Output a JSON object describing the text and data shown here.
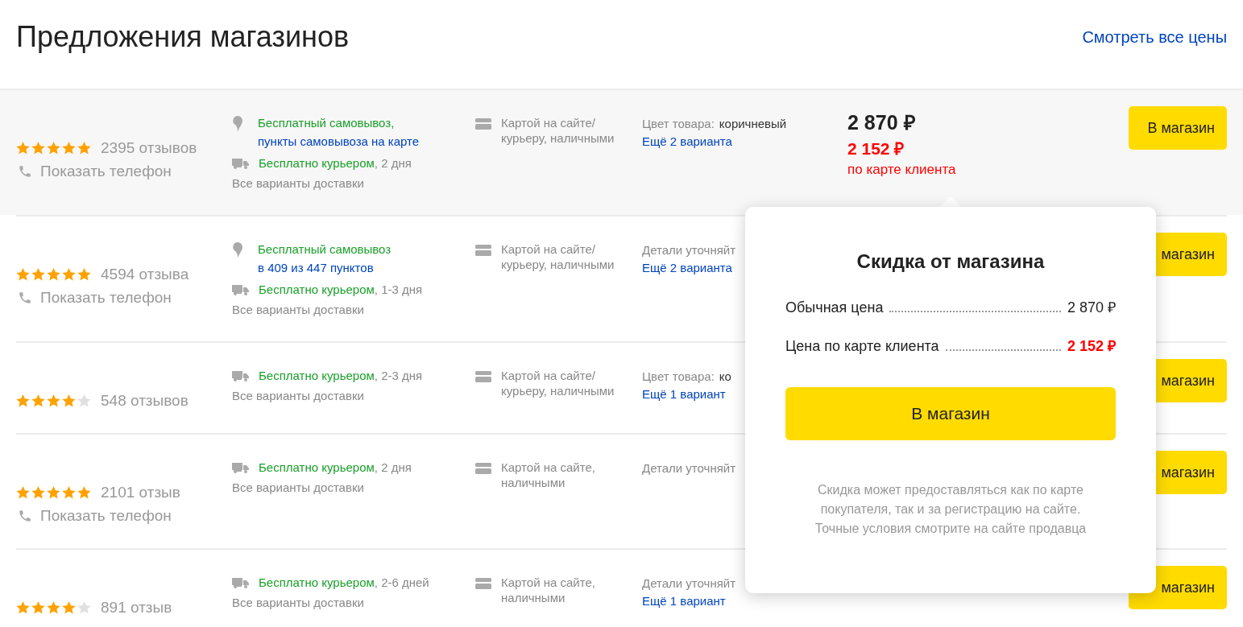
{
  "header": {
    "title": "Предложения магазинов",
    "link": "Смотреть все цены"
  },
  "rows": [
    {
      "highlighted": true,
      "stars": 5,
      "reviews": "2395 отзывов",
      "phone": "Показать телефон",
      "delivery": [
        {
          "kind": "pickup",
          "title": "Бесплатный самовывоз,",
          "note": "пункты самовывоза на карте"
        },
        {
          "kind": "courier",
          "title": "Бесплатно курьером",
          "term": ", 2 дня"
        }
      ],
      "all_delivery": "Все варианты доставки",
      "payment": "Картой на сайте/ курьеру, наличными",
      "details": {
        "label": "Цвет товара:",
        "value": "коричневый"
      },
      "variants": "Ещё 2 варианта",
      "price": {
        "regular": "2 870 ₽",
        "card": "2 152 ₽",
        "card_note": "по карте клиента"
      },
      "button": "В магазин"
    },
    {
      "highlighted": false,
      "stars": 5,
      "reviews": "4594 отзыва",
      "phone": "Показать телефон",
      "delivery": [
        {
          "kind": "pickup",
          "title": "Бесплатный самовывоз",
          "note": "в 409 из 447 пунктов"
        },
        {
          "kind": "courier",
          "title": "Бесплатно курьером",
          "term": ", 1-3 дня"
        }
      ],
      "all_delivery": "Все варианты доставки",
      "payment": "Картой на сайте/ курьеру, наличными",
      "details": {
        "label": "Детали уточняйт"
      },
      "variants": "Ещё 2 варианта",
      "button": "магазин"
    },
    {
      "highlighted": false,
      "stars": 4,
      "reviews": "548 отзывов",
      "delivery": [
        {
          "kind": "courier",
          "title": "Бесплатно курьером",
          "term": ", 2-3 дня"
        }
      ],
      "all_delivery": "Все варианты доставки",
      "payment": "Картой на сайте/ курьеру, наличными",
      "details": {
        "label": "Цвет товара:",
        "value": "ко"
      },
      "variants": "Ещё 1 вариант",
      "button": "магазин"
    },
    {
      "highlighted": false,
      "stars": 5,
      "reviews": "2101 отзыв",
      "phone": "Показать телефон",
      "delivery": [
        {
          "kind": "courier",
          "title": "Бесплатно курьером",
          "term": ", 2 дня"
        }
      ],
      "all_delivery": "Все варианты доставки",
      "payment": "Картой на сайте, наличными",
      "details": {
        "label": "Детали уточняйт"
      },
      "button": "магазин"
    },
    {
      "highlighted": false,
      "stars": 4,
      "reviews": "891 отзыв",
      "delivery": [
        {
          "kind": "courier",
          "title": "Бесплатно курьером",
          "term": ", 2-6 дней"
        }
      ],
      "all_delivery": "Все варианты доставки",
      "payment": "Картой на сайте, наличными",
      "details": {
        "label": "Детали уточняйт"
      },
      "variants": "Ещё 1 вариант",
      "button": "магазин"
    }
  ],
  "popover": {
    "title": "Скидка от магазина",
    "lines": [
      {
        "kind": "regular",
        "label": "Обычная цена",
        "value": "2 870 ₽"
      },
      {
        "kind": "card",
        "label": "Цена по карте клиента",
        "value": "2 152 ₽"
      }
    ],
    "button": "В магазин",
    "note": "Скидка может предоставляться как по карте покупателя, так и за регистрацию на сайте. Точные условия смотрите на сайте продавца"
  }
}
